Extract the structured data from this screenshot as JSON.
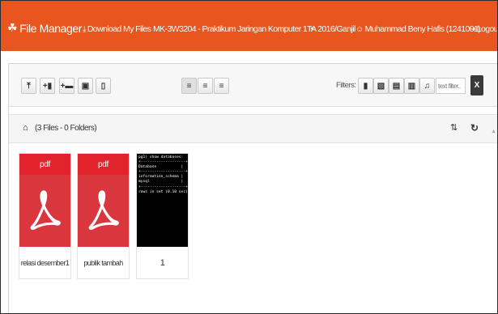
{
  "nav": {
    "brand": "File Manager",
    "download": "Download My Files",
    "course": "MK-3W3204 - Praktikum Jaringan Komputer 1",
    "term": "TA 2016/Ganjil",
    "user": "Muhammad Beny Hafis (1241001)",
    "logout": "Logout"
  },
  "toolbar": {
    "filters_label": "Filters:",
    "filter_placeholder": "text filter..",
    "clear_label": "X"
  },
  "path": {
    "summary": "(3 Files - 0 Folders)"
  },
  "files": [
    {
      "ext": "pdf",
      "name": "relasi desember1",
      "type": "pdf"
    },
    {
      "ext": "pdf",
      "name": "publik tambah",
      "type": "pdf"
    },
    {
      "name": "1",
      "type": "image",
      "preview_lines": [
        "pg1) show databases:",
        "+--------------------+",
        "Database           |",
        "+--------------------+",
        "information_schema |",
        "mysql              |",
        "+--------------------+",
        "rows in set (0.10 sec)"
      ]
    }
  ],
  "colors": {
    "navbar": "#e8551f",
    "pdf_band": "#e1242c",
    "pdf_body": "#d9363e"
  },
  "icons": {
    "brand": "sitemap-icon",
    "download": "download-icon",
    "user": "user-icon",
    "logout": "logout-icon"
  }
}
